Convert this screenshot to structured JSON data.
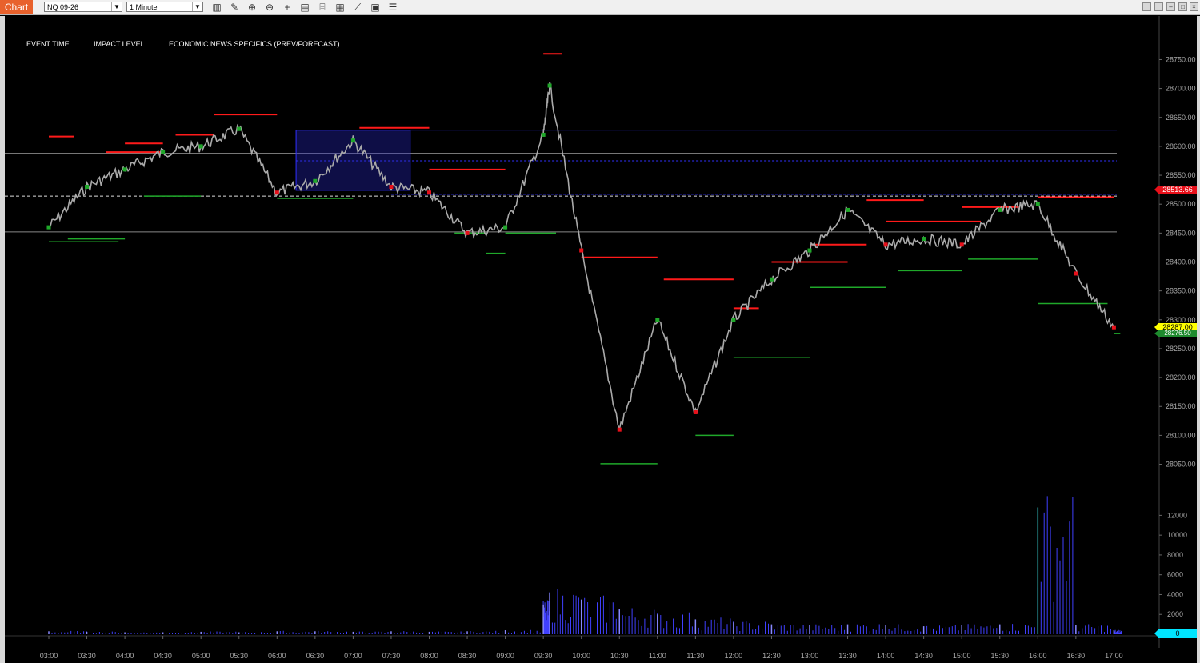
{
  "window": {
    "tab_label": "Chart"
  },
  "toolbar": {
    "symbol": "NQ 09-26",
    "timeframe": "1 Minute",
    "tools": [
      "bars-icon",
      "pencil-icon",
      "zoom-in-icon",
      "zoom-out-icon",
      "crosshair-icon",
      "properties-icon",
      "template-icon",
      "data-box-icon",
      "indicators-icon",
      "strategies-icon",
      "list-icon"
    ]
  },
  "news_panel": {
    "col_event_time": "EVENT TIME",
    "col_impact": "IMPACT LEVEL",
    "col_specifics": "ECONOMIC NEWS SPECIFICS (PREV/FORECAST)"
  },
  "price_axis": {
    "labels": [
      "28750.00",
      "28700.00",
      "28650.00",
      "28600.00",
      "28550.00",
      "28500.00",
      "28450.00",
      "28400.00",
      "28350.00",
      "28300.00",
      "28250.00",
      "28200.00",
      "28150.00",
      "28100.00",
      "28050.00"
    ]
  },
  "volume_axis": {
    "labels": [
      "12000",
      "10000",
      "8000",
      "6000",
      "4000",
      "2000"
    ]
  },
  "time_axis": {
    "labels": [
      "03:00",
      "03:30",
      "04:00",
      "04:30",
      "05:00",
      "05:30",
      "06:00",
      "06:30",
      "07:00",
      "07:30",
      "08:00",
      "08:30",
      "09:00",
      "09:30",
      "10:00",
      "10:30",
      "11:00",
      "11:30",
      "12:00",
      "12:30",
      "13:00",
      "13:30",
      "14:00",
      "14:30",
      "15:00",
      "15:30",
      "16:00",
      "16:30",
      "17:00"
    ]
  },
  "markers": {
    "red_level": "28513.66",
    "last_price": "28287.00",
    "green_level": "28276.50",
    "volume_last": "0"
  },
  "colors": {
    "up": "#aaaaaa",
    "down": "#3b3bff",
    "resistance": "#ff1a1a",
    "support": "#1fa82a",
    "volume_spike": "#36c5c5"
  },
  "chart_data": {
    "type": "line",
    "x": [
      "03:00",
      "03:30",
      "04:00",
      "04:30",
      "05:00",
      "05:30",
      "06:00",
      "06:30",
      "07:00",
      "07:30",
      "08:00",
      "08:30",
      "09:00",
      "09:30",
      "09:35",
      "10:00",
      "10:30",
      "11:00",
      "11:30",
      "12:00",
      "12:30",
      "13:00",
      "13:30",
      "14:00",
      "14:30",
      "15:00",
      "15:30",
      "16:00",
      "16:30",
      "17:00"
    ],
    "series": [
      {
        "values": [
          28460,
          28530,
          28560,
          28590,
          28600,
          28630,
          28520,
          28540,
          28610,
          28530,
          28520,
          28450,
          28460,
          28620,
          28705,
          28420,
          28110,
          28300,
          28140,
          28300,
          28370,
          28420,
          28490,
          28430,
          28440,
          28430,
          28490,
          28500,
          28380,
          28287
        ]
      }
    ],
    "ylim": [
      28030,
      28770
    ],
    "volume": [
      300,
      250,
      200,
      200,
      250,
      200,
      300,
      300,
      250,
      300,
      250,
      300,
      400,
      3000,
      4200,
      3500,
      2500,
      2000,
      1500,
      1200,
      1000,
      900,
      1000,
      900,
      800,
      900,
      1000,
      12800,
      900,
      400
    ],
    "volume_ylim": [
      0,
      13000
    ]
  }
}
